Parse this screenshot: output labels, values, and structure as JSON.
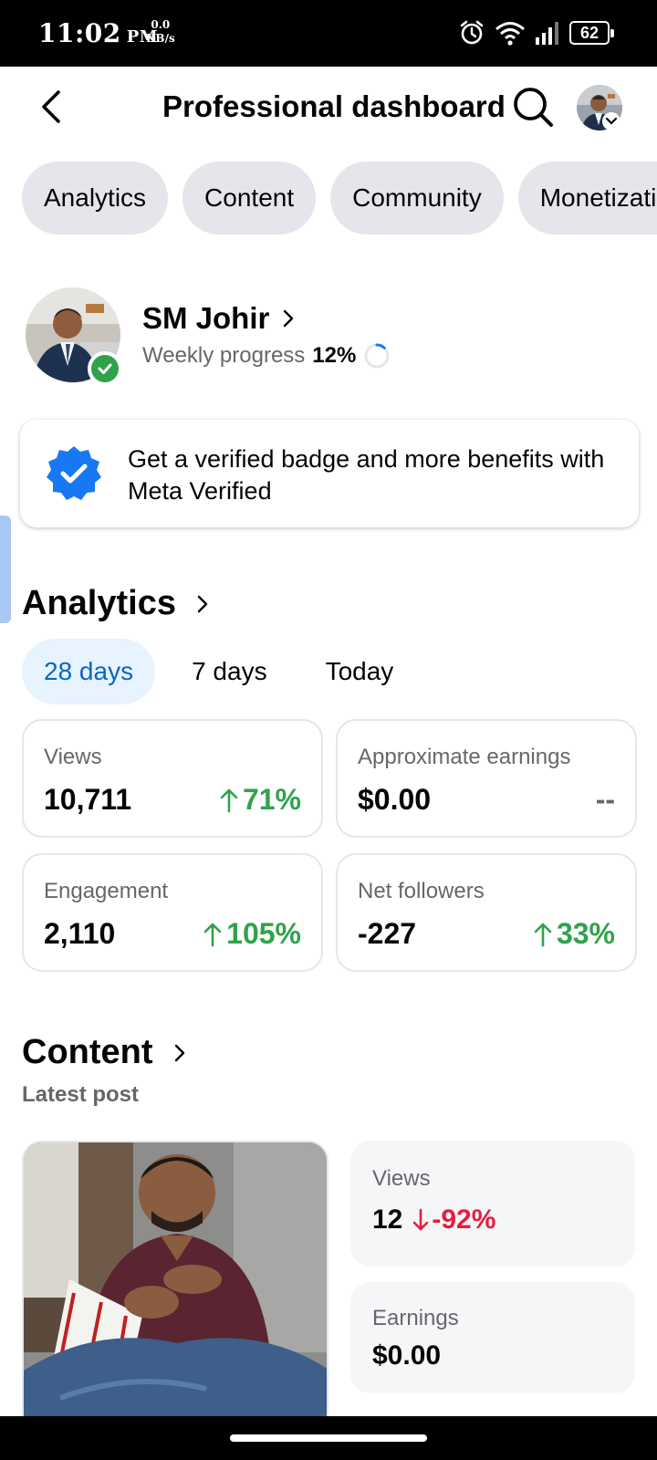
{
  "status_bar": {
    "time": "11:02",
    "ampm": "PM",
    "net_speed_value": "0.0",
    "net_speed_unit": "KB/s",
    "battery": "62",
    "icons": [
      "alarm-icon",
      "wifi-icon",
      "signal-icon",
      "battery-icon"
    ]
  },
  "header": {
    "title": "Professional dashboard",
    "icons": [
      "back-arrow-icon",
      "search-icon",
      "profile-avatar-icon",
      "chevron-down-icon"
    ]
  },
  "tabs": [
    "Analytics",
    "Content",
    "Community",
    "Monetization"
  ],
  "profile": {
    "name": "SM Johir",
    "weekly_progress_label": "Weekly progress",
    "weekly_progress_value": "12%",
    "progress_fraction": 0.12
  },
  "meta_verified": {
    "text": "Get a verified badge and more benefits with Meta Verified"
  },
  "analytics": {
    "heading": "Analytics",
    "ranges": [
      "28 days",
      "7 days",
      "Today"
    ],
    "selected_range": "28 days",
    "metrics": [
      {
        "label": "Views",
        "value": "10,711",
        "trend": "71%",
        "direction": "up"
      },
      {
        "label": "Approximate earnings",
        "value": "$0.00",
        "trend": "--",
        "direction": "none"
      },
      {
        "label": "Engagement",
        "value": "2,110",
        "trend": "105%",
        "direction": "up"
      },
      {
        "label": "Net followers",
        "value": "-227",
        "trend": "33%",
        "direction": "up"
      }
    ]
  },
  "content": {
    "heading": "Content",
    "subheading": "Latest post",
    "views_label": "Views",
    "views_value": "12",
    "views_trend": "-92%",
    "earnings_label": "Earnings",
    "earnings_value": "$0.00"
  },
  "colors": {
    "accent_blue": "#0a66c2",
    "positive_green": "#31a24c",
    "negative_red": "#e41e3f",
    "chip_gray": "#e4e6eb"
  }
}
